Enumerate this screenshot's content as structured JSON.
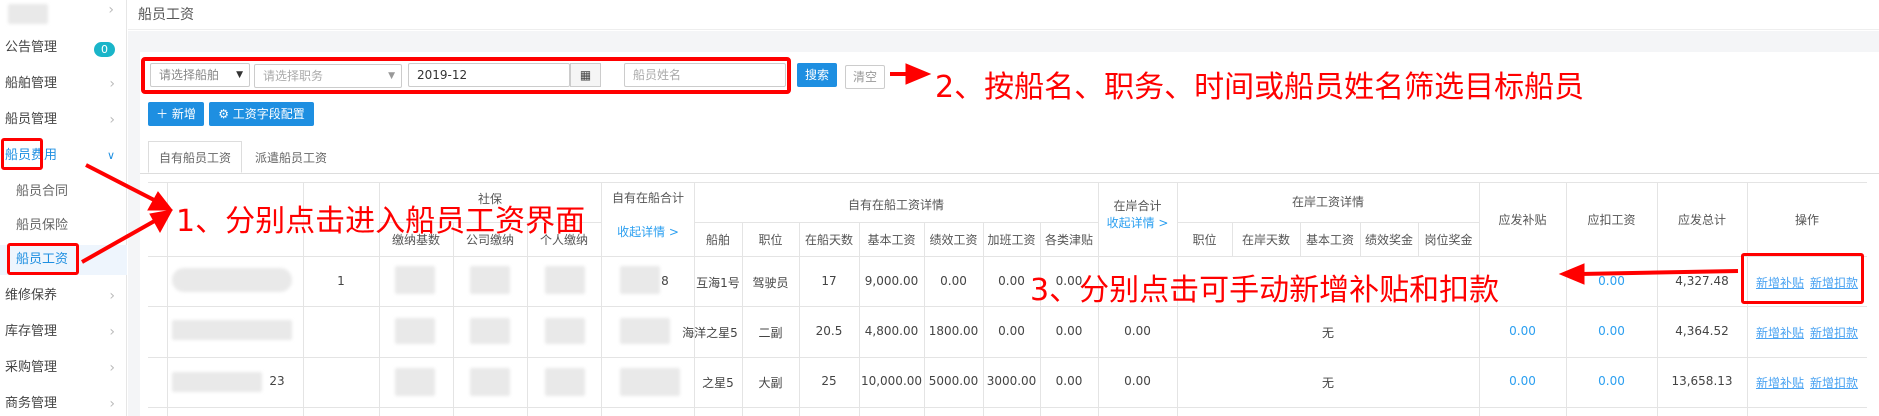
{
  "sidebar": {
    "items": [
      {
        "label": "公告管理",
        "badge": "0"
      },
      {
        "label": "船舶管理"
      },
      {
        "label": "船员管理"
      },
      {
        "label": "船员费用"
      },
      {
        "label": "船员合同"
      },
      {
        "label": "船员保险"
      },
      {
        "label": "船员工资"
      },
      {
        "label": "维修保养"
      },
      {
        "label": "库存管理"
      },
      {
        "label": "采购管理"
      },
      {
        "label": "商务管理"
      }
    ]
  },
  "header": {
    "title": "船员工资"
  },
  "filters": {
    "ship_placeholder": "请选择船舶",
    "position_placeholder": "请选择职务",
    "date_value": "2019-12",
    "name_placeholder": "船员姓名",
    "search_label": "搜索",
    "reset_label": "清空"
  },
  "toolbar": {
    "add_label": "新增",
    "config_label": "工资字段配置"
  },
  "tabs": [
    "自有船员工资",
    "派遣船员工资"
  ],
  "table": {
    "headers": {
      "social": "社保",
      "social_base": "缴纳基数",
      "social_company": "公司缴纳",
      "social_personal": "个人缴纳",
      "onboard_total": "自有在船合计",
      "collapse": "收起详情 >",
      "onboard_detail": "自有在船工资详情",
      "ship": "船舶",
      "position": "职位",
      "days_onboard": "在船天数",
      "base_salary": "基本工资",
      "perf_salary": "绩效工资",
      "overtime": "加班工资",
      "allowance": "各类津贴",
      "ashore_total": "在岸合计",
      "ashore_detail": "在岸工资详情",
      "ashore_position": "职位",
      "ashore_days": "在岸天数",
      "ashore_base": "基本工资",
      "ashore_perf": "绩效奖金",
      "ashore_post": "岗位奖金",
      "subsidy_due": "应发补贴",
      "deduct_due": "应扣工资",
      "total_due": "应发总计",
      "ops": "操作"
    },
    "rows": [
      {
        "index": "1",
        "onboard_suffix": "8",
        "ship": "互海1号",
        "position": "驾驶员",
        "days": "17",
        "base": "9,000.00",
        "perf": "0.00",
        "overtime": "0.00",
        "allowance": "0.00",
        "ashore_total": "",
        "ashore_detail": "",
        "subsidy": "",
        "deduct": "0.00",
        "total": "4,327.48",
        "add_subsidy": "新增补贴",
        "add_deduct": "新增扣款"
      },
      {
        "index": "",
        "onboard_suffix": "",
        "ship": "海洋之星5",
        "position": "二副",
        "days": "20.5",
        "base": "4,800.00",
        "perf": "1800.00",
        "overtime": "0.00",
        "allowance": "0.00",
        "ashore_total": "0.00",
        "ashore_detail": "无",
        "subsidy": "0.00",
        "deduct": "0.00",
        "total": "4,364.52",
        "add_subsidy": "新增补贴",
        "add_deduct": "新增扣款"
      },
      {
        "index": "",
        "onboard_suffix": "23",
        "ship": "之星5",
        "position": "大副",
        "days": "25",
        "base": "10,000.00",
        "perf": "5000.00",
        "overtime": "3000.00",
        "allowance": "0.00",
        "ashore_total": "0.00",
        "ashore_detail": "无",
        "subsidy": "0.00",
        "deduct": "0.00",
        "total": "13,658.13",
        "add_subsidy": "新增补贴",
        "add_deduct": "新增扣款"
      }
    ]
  },
  "annotations": {
    "note1": "1、分别点击进入船员工资界面",
    "note2": "2、按船名、职务、时间或船员姓名筛选目标船员",
    "note3": "3、分别点击可手动新增补贴和扣款",
    "color": "#ff0000"
  }
}
